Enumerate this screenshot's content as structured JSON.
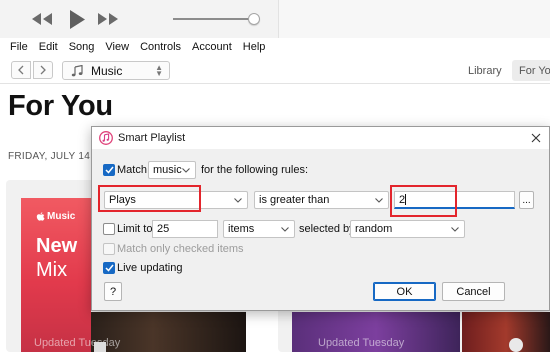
{
  "player": {
    "prev_icon": "rewind-icon",
    "play_icon": "play-icon",
    "next_icon": "fast-forward-icon",
    "volume_level": 0.95
  },
  "menubar": {
    "items": [
      "File",
      "Edit",
      "Song",
      "View",
      "Controls",
      "Account",
      "Help"
    ]
  },
  "nav": {
    "media_kind": "Music",
    "tabs": {
      "library": "Library",
      "for_you": "For You"
    }
  },
  "page": {
    "title": "For You",
    "date": "FRIDAY, JULY 14",
    "cards": {
      "brand": "Music",
      "mix_title_line1": "New",
      "mix_title_line2": "Mix",
      "updated_1": "Updated Tuesday",
      "updated_2": "Updated Tuesday"
    }
  },
  "dialog": {
    "title": "Smart Playlist",
    "match_checked": true,
    "match_label": "Match",
    "match_kind": "music",
    "match_suffix": "for the following rules:",
    "rule": {
      "field": "Plays",
      "operator": "is greater than",
      "value": "2",
      "more_label": "..."
    },
    "limit": {
      "checked": false,
      "label": "Limit to",
      "amount": "25",
      "unit": "items",
      "selected_by_label": "selected by",
      "selected_by": "random"
    },
    "match_only_checked_label": "Match only checked items",
    "live_updating_checked": true,
    "live_updating_label": "Live updating",
    "help_label": "?",
    "ok_label": "OK",
    "cancel_label": "Cancel"
  },
  "colors": {
    "accent": "#1769c4",
    "highlight": "#e3252c",
    "music_card": "#ee4d5c"
  }
}
